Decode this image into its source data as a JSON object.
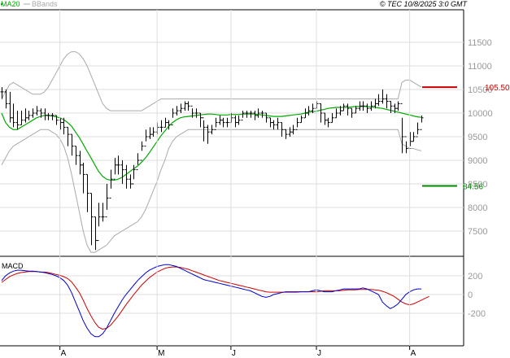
{
  "header": {
    "ma_label": "MA20",
    "bb_label": "BBands",
    "source": "© TEC 10/8/2025 3:0 GMT"
  },
  "macd_label": "MACD",
  "levels": {
    "resistance": "105.50",
    "support": "84.56"
  },
  "colors": {
    "ma": "#00aa00",
    "bbands": "#aaaaaa",
    "candle": "#000000",
    "macd": "#0000cc",
    "signal": "#cc0000",
    "resistance": "#cc0000",
    "support": "#008800",
    "grid": "#dddddd"
  },
  "chart_data": [
    {
      "type": "ohlc",
      "name": "price",
      "y_ticks": [
        7500,
        8000,
        8500,
        9000,
        9500,
        10000,
        10500,
        11000,
        11500
      ],
      "ylim": [
        7000,
        12000
      ],
      "x_month_labels": [
        "A",
        "M",
        "J",
        "J",
        "A"
      ],
      "x_month_positions": [
        15,
        40,
        59,
        81,
        105
      ],
      "n_bars": 109,
      "close": [
        10450,
        10200,
        9900,
        9800,
        9750,
        9850,
        9900,
        9950,
        10000,
        10050,
        10000,
        9950,
        9950,
        9950,
        9850,
        9800,
        9700,
        9550,
        9300,
        9100,
        8900,
        8700,
        8300,
        7800,
        7300,
        7800,
        7800,
        8200,
        8600,
        8900,
        8900,
        8800,
        8600,
        8500,
        8800,
        9000,
        9300,
        9500,
        9550,
        9600,
        9700,
        9700,
        9800,
        9750,
        10000,
        10050,
        10100,
        10200,
        10150,
        10000,
        10000,
        9900,
        9700,
        9600,
        9650,
        9800,
        9850,
        9800,
        9800,
        9900,
        9800,
        9850,
        10000,
        10000,
        10000,
        9950,
        10000,
        10000,
        9900,
        9800,
        9750,
        9800,
        9650,
        9550,
        9600,
        9650,
        9800,
        9900,
        10000,
        10050,
        10100,
        10200,
        10000,
        9850,
        9800,
        9900,
        10000,
        10050,
        10150,
        10100,
        10000,
        10100,
        10150,
        10150,
        10100,
        10150,
        10200,
        10250,
        10300,
        10250,
        10150,
        10100,
        10200,
        9500,
        9250,
        9400,
        9500,
        9650,
        9900
      ],
      "high": [
        10550,
        10500,
        10450,
        10200,
        10050,
        10050,
        10100,
        10050,
        10100,
        10150,
        10100,
        10100,
        10000,
        10000,
        9950,
        9900,
        9900,
        9700,
        9550,
        9300,
        9200,
        8950,
        8700,
        8300,
        7800,
        8100,
        8100,
        8500,
        8800,
        9050,
        9100,
        9000,
        8900,
        8700,
        8900,
        9150,
        9400,
        9650,
        9700,
        9700,
        9800,
        9850,
        9900,
        9850,
        10100,
        10150,
        10200,
        10250,
        10250,
        10100,
        10100,
        10000,
        9850,
        9750,
        9750,
        9900,
        9950,
        9900,
        9900,
        10000,
        9950,
        9950,
        10050,
        10050,
        10050,
        10050,
        10100,
        10050,
        10000,
        9900,
        9850,
        9900,
        9800,
        9650,
        9700,
        9750,
        9900,
        9950,
        10100,
        10150,
        10200,
        10250,
        10200,
        10000,
        9900,
        10000,
        10100,
        10150,
        10200,
        10200,
        10100,
        10150,
        10250,
        10250,
        10200,
        10250,
        10300,
        10400,
        10500,
        10400,
        10250,
        10200,
        10250,
        9900,
        9400,
        9600,
        9600,
        9800,
        9950
      ],
      "low": [
        10300,
        10100,
        9800,
        9700,
        9650,
        9750,
        9800,
        9850,
        9900,
        9950,
        9900,
        9850,
        9850,
        9850,
        9750,
        9650,
        9550,
        9300,
        9100,
        8900,
        8700,
        8300,
        7900,
        7200,
        7100,
        7600,
        7700,
        7950,
        8400,
        8700,
        8700,
        8500,
        8400,
        8400,
        8600,
        8900,
        9200,
        9400,
        9450,
        9500,
        9550,
        9600,
        9700,
        9650,
        9900,
        9950,
        10000,
        10050,
        10050,
        9900,
        9900,
        9700,
        9400,
        9350,
        9550,
        9700,
        9750,
        9700,
        9700,
        9800,
        9700,
        9750,
        9900,
        9900,
        9900,
        9850,
        9900,
        9900,
        9800,
        9700,
        9650,
        9650,
        9500,
        9450,
        9500,
        9550,
        9700,
        9800,
        9900,
        9950,
        10000,
        10100,
        9800,
        9750,
        9700,
        9800,
        9900,
        9950,
        10050,
        9950,
        9900,
        10000,
        10050,
        10050,
        10000,
        10050,
        10100,
        10150,
        10200,
        10100,
        10000,
        10000,
        10050,
        9150,
        9150,
        9300,
        9400,
        9550,
        9800
      ],
      "ma20": [
        10000,
        9800,
        9700,
        9650,
        9650,
        9700,
        9750,
        9800,
        9850,
        9900,
        9930,
        9950,
        9950,
        9940,
        9920,
        9900,
        9860,
        9800,
        9720,
        9600,
        9480,
        9340,
        9190,
        9050,
        8900,
        8760,
        8660,
        8600,
        8580,
        8580,
        8600,
        8640,
        8700,
        8760,
        8820,
        8880,
        8960,
        9050,
        9160,
        9280,
        9400,
        9520,
        9620,
        9720,
        9800,
        9860,
        9900,
        9920,
        9930,
        9940,
        9950,
        9960,
        9970,
        9980,
        9980,
        9970,
        9960,
        9960,
        9960,
        9970,
        9970,
        9970,
        9980,
        9980,
        9980,
        9980,
        9970,
        9960,
        9950,
        9940,
        9930,
        9930,
        9930,
        9940,
        9950,
        9960,
        9970,
        9980,
        10000,
        10020,
        10030,
        10040,
        10060,
        10080,
        10100,
        10110,
        10120,
        10120,
        10120,
        10120,
        10130,
        10140,
        10140,
        10140,
        10140,
        10130,
        10120,
        10110,
        10100,
        10080,
        10060,
        10040,
        10020,
        10000,
        9980,
        9960,
        9940,
        9920,
        9910
      ],
      "bb_upper": [
        10300,
        10450,
        10600,
        10650,
        10600,
        10550,
        10500,
        10450,
        10400,
        10400,
        10400,
        10450,
        10550,
        10700,
        10850,
        11000,
        11150,
        11250,
        11300,
        11300,
        11250,
        11150,
        11000,
        10800,
        10600,
        10400,
        10200,
        10100,
        10050,
        10050,
        10050,
        10050,
        10050,
        10050,
        10050,
        10050,
        10050,
        10100,
        10150,
        10200,
        10250,
        10300,
        10300,
        10300,
        10300,
        10300,
        10300,
        10300,
        10300,
        10300,
        10300,
        10300,
        10300,
        10300,
        10300,
        10300,
        10300,
        10300,
        10300,
        10300,
        10300,
        10300,
        10300,
        10300,
        10300,
        10300,
        10300,
        10300,
        10300,
        10300,
        10300,
        10300,
        10300,
        10300,
        10300,
        10300,
        10300,
        10300,
        10300,
        10300,
        10300,
        10300,
        10300,
        10300,
        10300,
        10300,
        10300,
        10300,
        10300,
        10300,
        10300,
        10300,
        10300,
        10300,
        10300,
        10300,
        10300,
        10300,
        10300,
        10300,
        10300,
        10300,
        10300,
        10650,
        10700,
        10700,
        10650,
        10600,
        10550
      ],
      "bb_lower": [
        8900,
        9050,
        9200,
        9300,
        9350,
        9400,
        9450,
        9500,
        9550,
        9600,
        9650,
        9650,
        9650,
        9600,
        9550,
        9450,
        9300,
        9050,
        8700,
        8300,
        7900,
        7500,
        7200,
        7050,
        7050,
        7100,
        7150,
        7200,
        7300,
        7400,
        7450,
        7500,
        7550,
        7600,
        7650,
        7700,
        7800,
        7950,
        8150,
        8350,
        8550,
        8800,
        9000,
        9250,
        9400,
        9500,
        9550,
        9600,
        9650,
        9650,
        9650,
        9650,
        9650,
        9650,
        9650,
        9650,
        9650,
        9650,
        9650,
        9650,
        9650,
        9650,
        9650,
        9650,
        9650,
        9650,
        9650,
        9650,
        9650,
        9650,
        9650,
        9650,
        9650,
        9650,
        9650,
        9650,
        9650,
        9650,
        9650,
        9650,
        9650,
        9650,
        9650,
        9650,
        9650,
        9650,
        9650,
        9650,
        9650,
        9650,
        9650,
        9650,
        9650,
        9650,
        9650,
        9650,
        9650,
        9650,
        9650,
        9650,
        9650,
        9650,
        9650,
        9350,
        9300,
        9250,
        9250,
        9220,
        9200
      ],
      "resistance": 10550,
      "support": 8456
    },
    {
      "type": "line",
      "name": "macd",
      "y_ticks": [
        -200,
        0,
        200
      ],
      "ylim": [
        -300,
        300
      ],
      "series": [
        {
          "name": "MACD",
          "values": [
            150,
            200,
            230,
            250,
            260,
            260,
            255,
            250,
            250,
            245,
            240,
            235,
            225,
            215,
            200,
            180,
            150,
            100,
            20,
            -80,
            -180,
            -280,
            -360,
            -420,
            -450,
            -450,
            -420,
            -360,
            -280,
            -200,
            -130,
            -60,
            0,
            50,
            100,
            150,
            190,
            230,
            260,
            280,
            300,
            310,
            320,
            320,
            310,
            300,
            280,
            260,
            240,
            220,
            200,
            180,
            160,
            150,
            140,
            130,
            120,
            110,
            100,
            90,
            80,
            70,
            60,
            50,
            40,
            20,
            0,
            -20,
            -30,
            -20,
            0,
            10,
            20,
            30,
            30,
            30,
            30,
            30,
            30,
            30,
            40,
            50,
            40,
            30,
            30,
            30,
            40,
            50,
            60,
            60,
            60,
            60,
            60,
            70,
            60,
            40,
            20,
            0,
            -80,
            -120,
            -150,
            -130,
            -100,
            -50,
            0,
            30,
            50,
            60,
            60
          ]
        },
        {
          "name": "Signal",
          "values": [
            130,
            160,
            190,
            210,
            225,
            235,
            240,
            245,
            245,
            245,
            242,
            240,
            235,
            225,
            215,
            205,
            190,
            170,
            135,
            80,
            20,
            -60,
            -150,
            -230,
            -300,
            -350,
            -370,
            -360,
            -330,
            -280,
            -230,
            -170,
            -110,
            -55,
            0,
            50,
            100,
            140,
            180,
            210,
            240,
            260,
            280,
            290,
            295,
            295,
            290,
            280,
            270,
            255,
            240,
            225,
            210,
            195,
            180,
            165,
            150,
            140,
            130,
            120,
            110,
            100,
            90,
            80,
            70,
            60,
            50,
            40,
            30,
            25,
            25,
            25,
            25,
            25,
            25,
            25,
            25,
            30,
            30,
            30,
            30,
            30,
            35,
            40,
            40,
            40,
            40,
            40,
            45,
            50,
            50,
            50,
            55,
            55,
            55,
            55,
            50,
            45,
            35,
            20,
            0,
            -20,
            -50,
            -80,
            -100,
            -110,
            -100,
            -80,
            -60,
            -40,
            -20
          ]
        }
      ]
    }
  ]
}
